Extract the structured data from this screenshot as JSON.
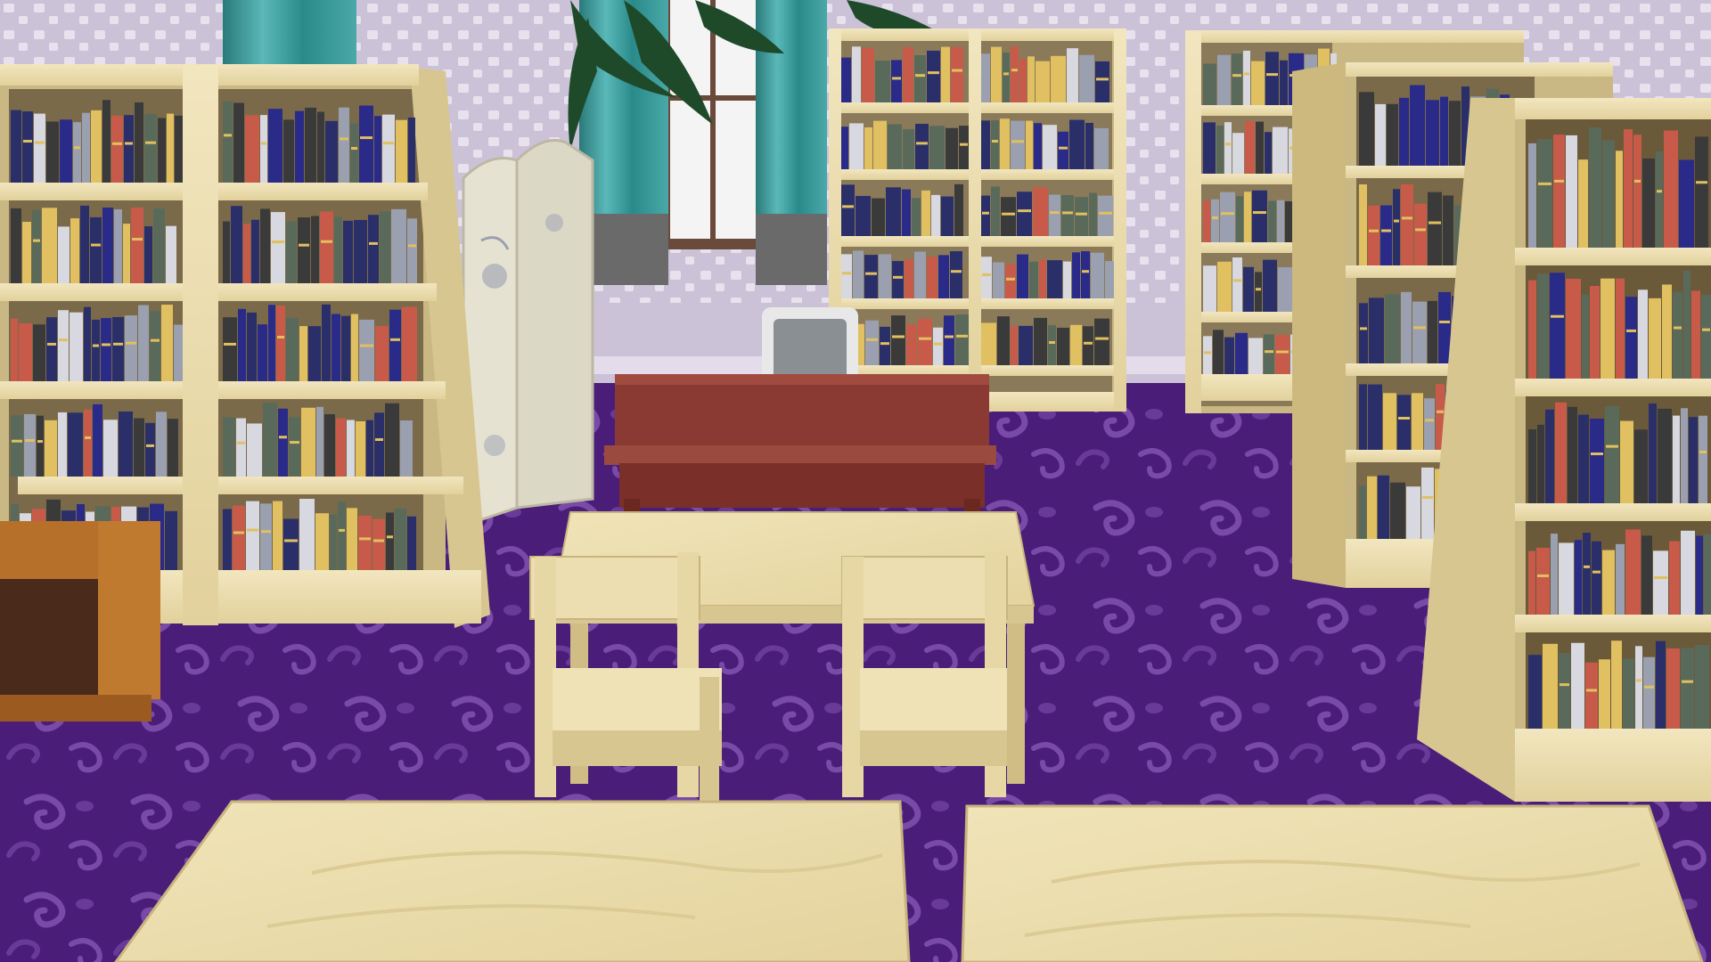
{
  "scene": {
    "description_visible_text": "",
    "colors": {
      "wall": "#c9bfd6",
      "wall_dots": "#e8e4ef",
      "carpet": "#4a1e78",
      "carpet_pattern": "#7a4aa8",
      "wood_light": "#eadcb0",
      "wood_mid": "#d8c690",
      "wood_shadow": "#b8a36a",
      "desk_red": "#8a3a32",
      "curtain": "#3a9a9a",
      "sofa": "#4a2a1a",
      "screen_panel": "#e6e2d2",
      "chair_back": "#8a8f94",
      "book_colors": [
        "#2a2f6a",
        "#c85a4a",
        "#d8d8e0",
        "#3a3a3a",
        "#2a2a88",
        "#e0c060",
        "#5a6a5a",
        "#9aa0b0"
      ]
    },
    "objects": [
      "bookshelf-left-double",
      "bookshelf-back-center-double",
      "bookshelf-back-right",
      "bookshelf-right-mid",
      "bookshelf-right-front",
      "folding-screen",
      "reception-desk",
      "office-chair",
      "study-table-middle",
      "wooden-chair-left",
      "wooden-chair-right",
      "study-table-front-left",
      "study-table-front-right",
      "sofa-left",
      "window-with-curtains",
      "plant-fronds"
    ]
  }
}
